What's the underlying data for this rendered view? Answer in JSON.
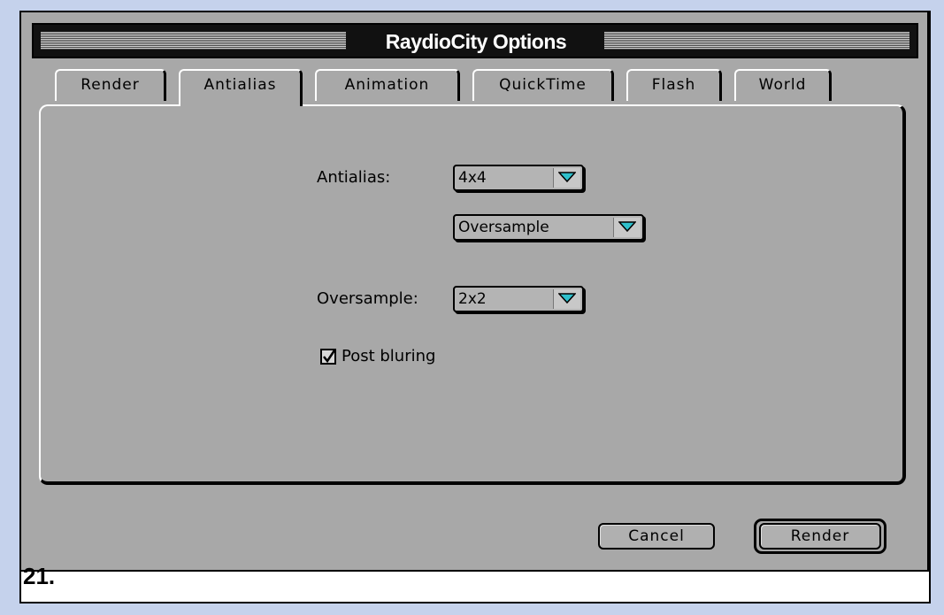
{
  "window": {
    "title": "RaydioCity Options"
  },
  "tabs": [
    {
      "label": "Render",
      "active": false
    },
    {
      "label": "Antialias",
      "active": true
    },
    {
      "label": "Animation",
      "active": false
    },
    {
      "label": "QuickTime",
      "active": false
    },
    {
      "label": "Flash",
      "active": false
    },
    {
      "label": "World",
      "active": false
    }
  ],
  "antialias_panel": {
    "antialias_label": "Antialias:",
    "antialias_value": "4x4",
    "mode_value": "Oversample",
    "oversample_label": "Oversample:",
    "oversample_value": "2x2",
    "post_bluring_label": "Post bluring",
    "post_bluring_checked": true
  },
  "buttons": {
    "cancel": "Cancel",
    "render": "Render"
  },
  "caption": "21.",
  "colors": {
    "window_bg": "#a8a8a8",
    "frame_bg": "#c5d2ec",
    "arrow_accent": "#2ec0cc"
  },
  "icons": {
    "popup_arrow": "triangle-down-icon",
    "checkbox": "checkmark-icon"
  }
}
